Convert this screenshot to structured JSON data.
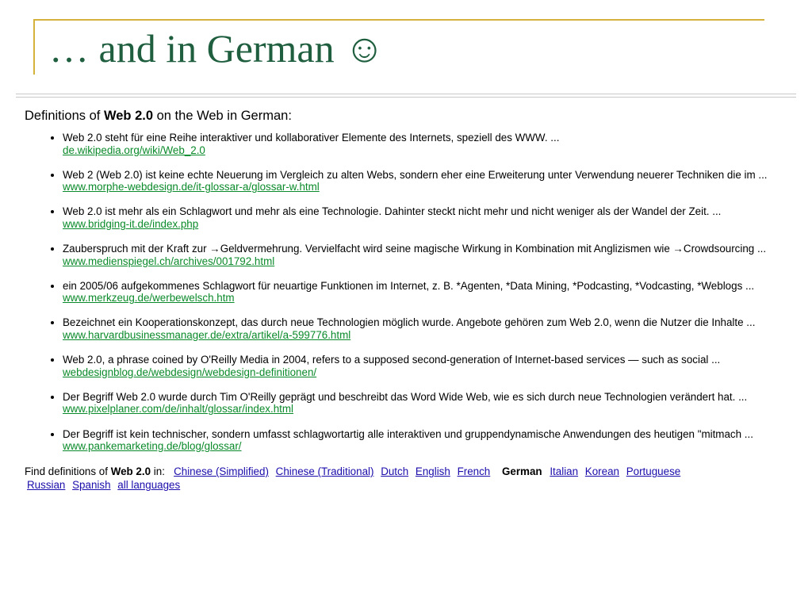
{
  "slide": {
    "title": "… and in German",
    "title_emoji": "☺"
  },
  "heading": {
    "prefix": "Definitions of ",
    "term": "Web 2.0",
    "suffix": " on the Web in German:"
  },
  "definitions": [
    {
      "text": "Web 2.0 steht für eine Reihe interaktiver und kollaborativer Elemente des Internets, speziell des WWW. ...",
      "link": "de.wikipedia.org/wiki/Web_2.0"
    },
    {
      "text": "Web 2 (Web 2.0) ist keine echte Neuerung im Vergleich zu alten Webs, sondern eher eine Erweiterung unter Verwendung neuerer Techniken die im ...",
      "link": "www.morphe-webdesign.de/it-glossar-a/glossar-w.html"
    },
    {
      "text": "Web 2.0 ist mehr als ein Schlagwort und mehr als eine Technologie. Dahinter steckt nicht mehr und nicht weniger als der Wandel der Zeit. ...",
      "link": "www.bridging-it.de/index.php"
    },
    {
      "text": "Zauberspruch mit der Kraft zur →Geldvermehrung. Vervielfacht wird seine magische Wirkung in Kombination mit Anglizismen wie →Crowdsourcing ...",
      "link": "www.medienspiegel.ch/archives/001792.html"
    },
    {
      "text": "ein 2005/06 aufgekommenes Schlagwort für neuartige Funktionen im Internet, z. B. *Agenten, *Data Mining, *Podcasting, *Vodcasting, *Weblogs ...",
      "link": "www.merkzeug.de/werbewelsch.htm"
    },
    {
      "text": "Bezeichnet ein Kooperationskonzept, das durch neue Technologien möglich wurde. Angebote gehören zum Web 2.0, wenn die Nutzer die Inhalte ...",
      "link": "www.harvardbusinessmanager.de/extra/artikel/a-599776.html"
    },
    {
      "text": "Web 2.0, a phrase coined by O'Reilly Media in 2004, refers to a supposed second-generation of Internet-based services — such as social ...",
      "link": "webdesignblog.de/webdesign/webdesign-definitionen/"
    },
    {
      "text": "Der Begriff Web 2.0 wurde durch Tim O'Reilly geprägt und beschreibt das Word Wide Web, wie es sich durch neue Technologien verändert hat. ...",
      "link": "www.pixelplaner.com/de/inhalt/glossar/index.html"
    },
    {
      "text": "Der Begriff ist kein technischer, sondern umfasst schlagwortartig alle interaktiven und gruppendynamische Anwendungen des heutigen \"mitmach ...",
      "link": "www.pankemarketing.de/blog/glossar/"
    }
  ],
  "find": {
    "prefix": "Find definitions of ",
    "term": "Web 2.0",
    "suffix": " in:",
    "languages": {
      "chinese_simplified": "Chinese (Simplified)",
      "chinese_traditional": "Chinese (Traditional)",
      "dutch": "Dutch",
      "english": "English",
      "french": "French",
      "german": "German",
      "italian": "Italian",
      "korean": "Korean",
      "portuguese": "Portuguese",
      "russian": "Russian",
      "spanish": "Spanish",
      "all": "all languages"
    }
  },
  "colors": {
    "title": "#1f5f3f",
    "accent": "#d4b23c",
    "result_link": "#0a8a2a",
    "language_link": "#1a0dab"
  }
}
